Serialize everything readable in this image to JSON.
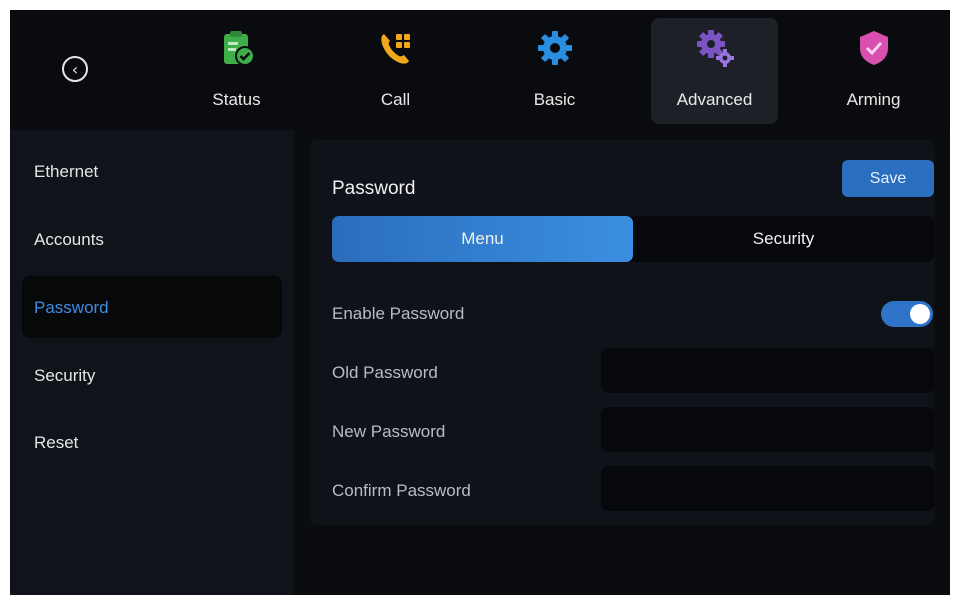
{
  "nav": {
    "back_glyph": "‹",
    "tabs": [
      {
        "label": "Status",
        "icon": "status-clipboard-icon",
        "color": "#3fae49"
      },
      {
        "label": "Call",
        "icon": "call-phone-icon",
        "color": "#f2a81d"
      },
      {
        "label": "Basic",
        "icon": "basic-gear-icon",
        "color": "#2a8fe0"
      },
      {
        "label": "Advanced",
        "icon": "advanced-gears-icon",
        "color": "#7a54c4"
      },
      {
        "label": "Arming",
        "icon": "arming-shield-icon",
        "color": "#d94fb0"
      }
    ],
    "active_tab": "Advanced"
  },
  "sidebar": {
    "items": [
      {
        "label": "Ethernet"
      },
      {
        "label": "Accounts"
      },
      {
        "label": "Password"
      },
      {
        "label": "Security"
      },
      {
        "label": "Reset"
      }
    ],
    "active_item": "Password"
  },
  "main": {
    "title": "Password",
    "save_label": "Save",
    "segments": [
      {
        "label": "Menu"
      },
      {
        "label": "Security"
      }
    ],
    "active_segment": "Menu",
    "enable_password_label": "Enable Password",
    "enable_password_on": true,
    "old_password_label": "Old Password",
    "old_password_value": "",
    "new_password_label": "New Password",
    "new_password_value": "",
    "confirm_password_label": "Confirm Password",
    "confirm_password_value": ""
  },
  "colors": {
    "accent": "#2a6fc0",
    "active_text": "#3d8de0",
    "background": "#0b0d12"
  }
}
